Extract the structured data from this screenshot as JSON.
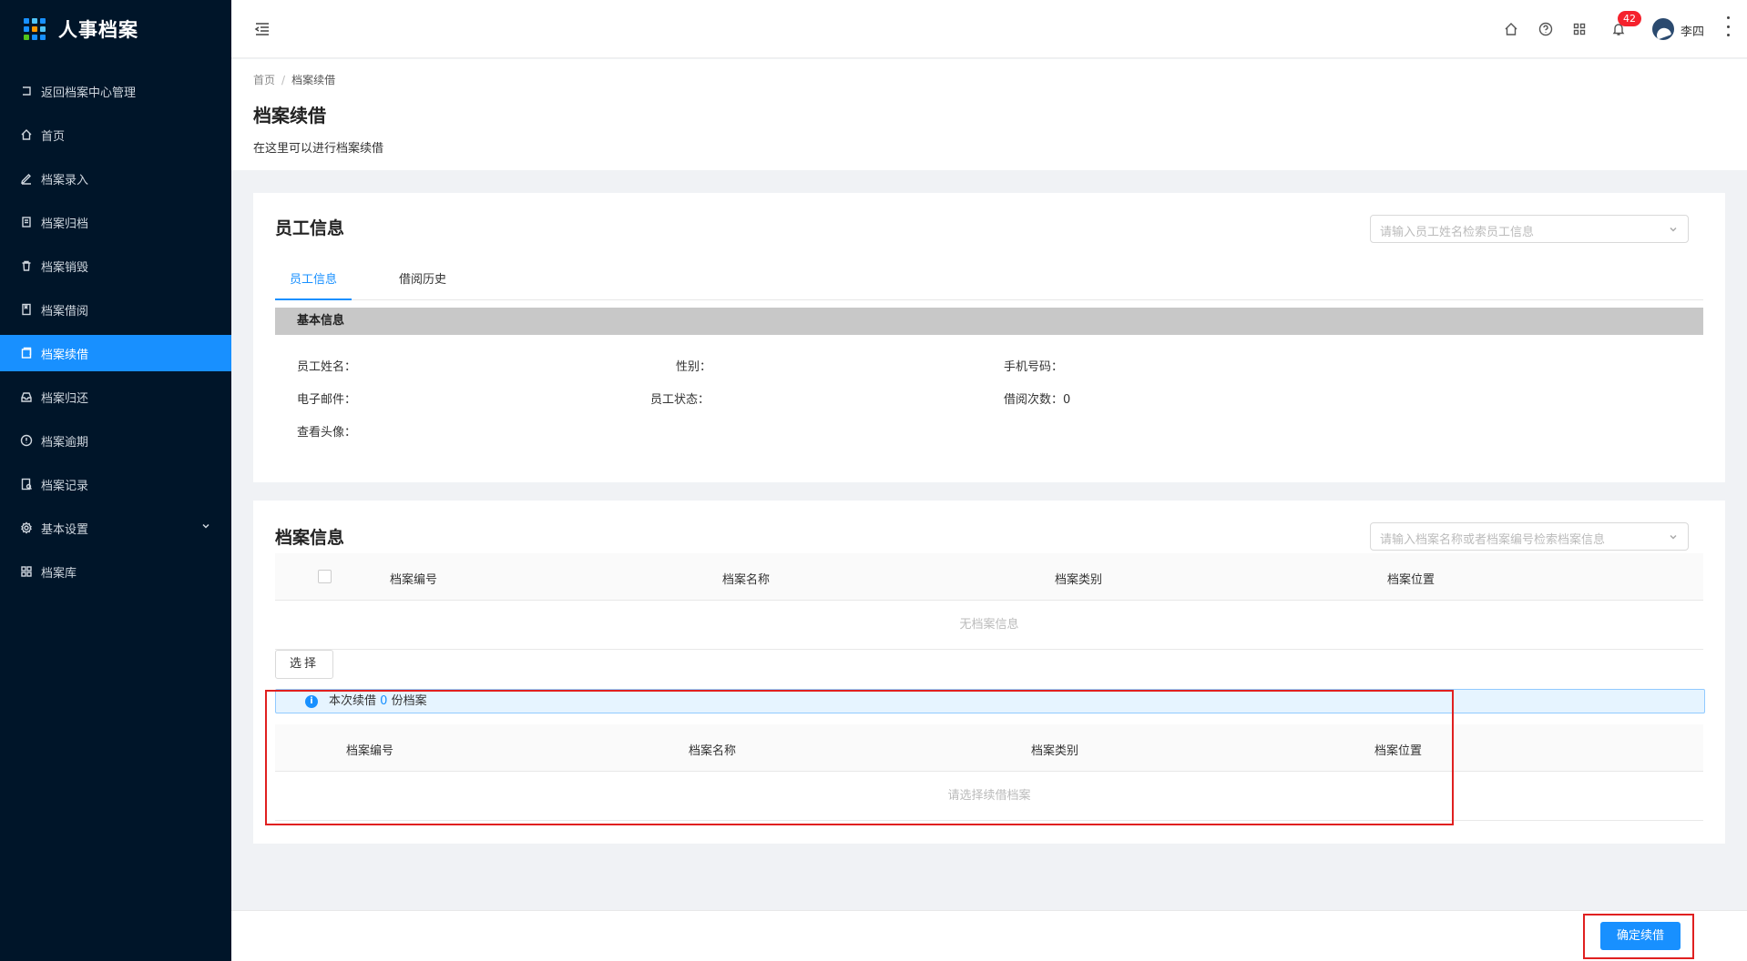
{
  "app": {
    "title": "人事档案"
  },
  "sidebar": {
    "items": [
      {
        "label": "返回档案中心管理",
        "icon": "return-icon"
      },
      {
        "label": "首页",
        "icon": "home-icon"
      },
      {
        "label": "档案录入",
        "icon": "edit-icon"
      },
      {
        "label": "档案归档",
        "icon": "archive-icon"
      },
      {
        "label": "档案销毁",
        "icon": "trash-icon"
      },
      {
        "label": "档案借阅",
        "icon": "book-icon"
      },
      {
        "label": "档案续借",
        "icon": "renew-icon",
        "active": true
      },
      {
        "label": "档案归还",
        "icon": "inbox-icon"
      },
      {
        "label": "档案逾期",
        "icon": "warning-icon"
      },
      {
        "label": "档案记录",
        "icon": "record-icon"
      },
      {
        "label": "基本设置",
        "icon": "gear-icon",
        "expandable": true
      },
      {
        "label": "档案库",
        "icon": "grid-icon"
      }
    ]
  },
  "header": {
    "notification_count": "42",
    "username": "李四"
  },
  "breadcrumb": {
    "home": "首页",
    "separator": "/",
    "current": "档案续借"
  },
  "page": {
    "title": "档案续借",
    "description": "在这里可以进行档案续借"
  },
  "employee": {
    "title": "员工信息",
    "search_placeholder": "请输入员工姓名检索员工信息",
    "tabs": [
      "员工信息",
      "借阅历史"
    ],
    "section_title": "基本信息",
    "fields": {
      "name": "员工姓名：",
      "gender": "性别：",
      "phone": "手机号码：",
      "email": "电子邮件：",
      "status": "员工状态：",
      "borrow_count": "借阅次数：0",
      "avatar": "查看头像："
    }
  },
  "archive": {
    "title": "档案信息",
    "search_placeholder": "请输入档案名称或者档案编号检索档案信息",
    "columns": [
      "档案编号",
      "档案名称",
      "档案类别",
      "档案位置"
    ],
    "empty_text": "无档案信息",
    "select_button": "选择",
    "alert_prefix": "本次续借",
    "alert_count": "0",
    "alert_suffix": "份档案",
    "selected_columns": [
      "档案编号",
      "档案名称",
      "档案类别",
      "档案位置"
    ],
    "selected_empty_text": "请选择续借档案"
  },
  "footer": {
    "confirm_button": "确定续借"
  },
  "colors": {
    "sidebar_bg": "#001529",
    "accent": "#1890ff",
    "badge": "#f5222d",
    "highlight": "#e02020"
  }
}
